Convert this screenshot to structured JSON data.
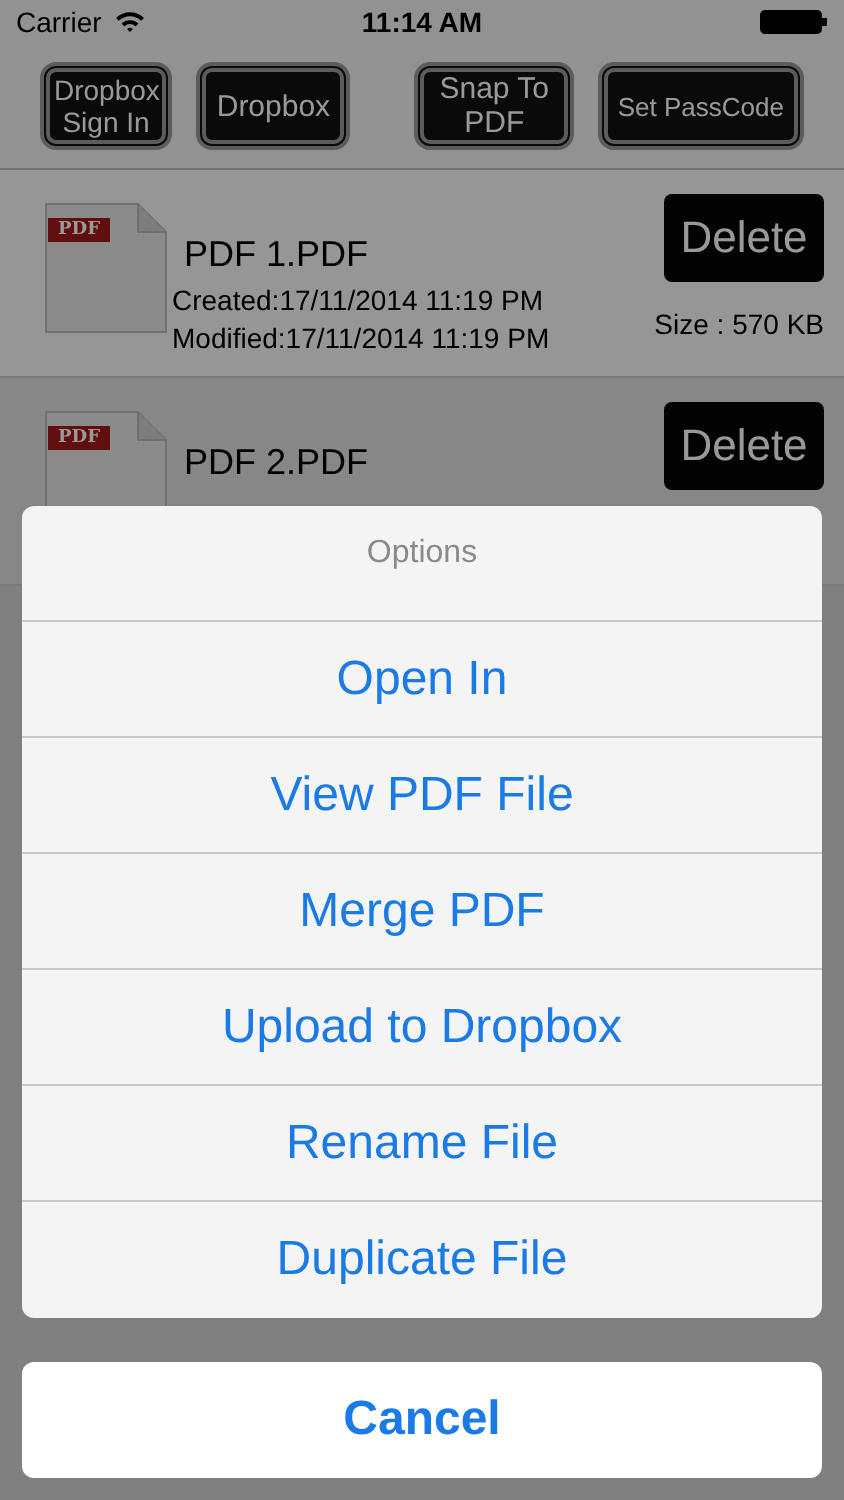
{
  "status_bar": {
    "carrier": "Carrier",
    "time": "11:14 AM"
  },
  "toolbar": [
    "Dropbox Sign In",
    "Dropbox",
    "Snap To PDF",
    "Set PassCode"
  ],
  "files": [
    {
      "name": "PDF 1.PDF",
      "created": "Created:17/11/2014 11:19 PM",
      "modified": "Modified:17/11/2014 11:19 PM",
      "size": "Size : 570 KB",
      "delete": "Delete",
      "icon_label": "PDF"
    },
    {
      "name": "PDF 2.PDF",
      "delete": "Delete",
      "icon_label": "PDF"
    }
  ],
  "action_sheet": {
    "title": "Options",
    "actions": [
      "Open In",
      "View PDF File",
      "Merge PDF",
      "Upload to Dropbox",
      "Rename File",
      "Duplicate File"
    ],
    "cancel": "Cancel"
  }
}
